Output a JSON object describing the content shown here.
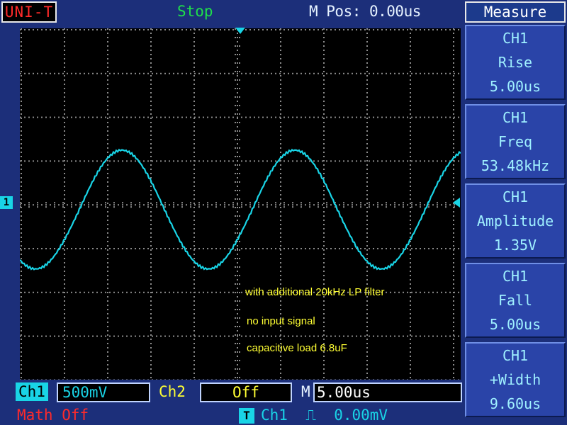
{
  "header": {
    "brand": "UNI-T",
    "status": "Stop",
    "mpos": "M Pos: 0.00us"
  },
  "measure_panel": {
    "title": "Measure",
    "items": [
      {
        "channel": "CH1",
        "label": "Rise",
        "value": "5.00us"
      },
      {
        "channel": "CH1",
        "label": "Freq",
        "value": "53.48kHz"
      },
      {
        "channel": "CH1",
        "label": "Amplitude",
        "value": "1.35V"
      },
      {
        "channel": "CH1",
        "label": "Fall",
        "value": "5.00us"
      },
      {
        "channel": "CH1",
        "label": "+Width",
        "value": "9.60us"
      }
    ]
  },
  "screen": {
    "annotations": [
      "with additional 20kHz LP filter",
      "no input signal",
      "capacitive load 6.8uF"
    ],
    "ch1_marker": "1",
    "trace_color": "#19d4e6",
    "signal": {
      "frequency": "53.48kHz",
      "amplitude": "1.35V"
    }
  },
  "bottom_bar": {
    "ch1_label": "Ch1",
    "ch1_scale": "500mV",
    "ch2_label": "Ch2",
    "ch2_scale": "Off",
    "time_label": "M",
    "time_scale": "5.00us",
    "math": "Math Off",
    "trigger_icon": "T",
    "trigger_info": "Ch1  ⎍  0.00mV"
  },
  "colors": {
    "background": "#1c2f7a",
    "trace": "#19d4e6",
    "annotation": "#ffff33",
    "status": "#1ee04a",
    "brand": "#ff2a2a"
  }
}
